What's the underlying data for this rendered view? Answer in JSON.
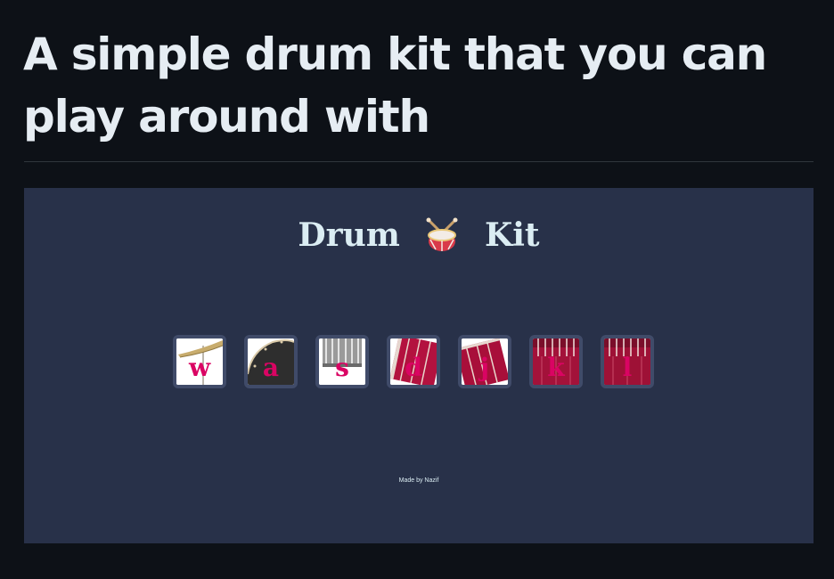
{
  "readme": {
    "heading": "A simple drum kit that you can play around with"
  },
  "preview": {
    "title_left": "Drum",
    "title_icon": "drum-emoji-icon",
    "title_right": "Kit",
    "keys": [
      {
        "letter": "w",
        "instrument": "crash-cymbal-icon"
      },
      {
        "letter": "a",
        "instrument": "kick-drum-icon"
      },
      {
        "letter": "s",
        "instrument": "snare-drum-icon"
      },
      {
        "letter": "d",
        "instrument": "tom-drum-icon"
      },
      {
        "letter": "j",
        "instrument": "tom-drum-icon"
      },
      {
        "letter": "k",
        "instrument": "tom-drum-icon"
      },
      {
        "letter": "l",
        "instrument": "tom-drum-icon"
      }
    ],
    "credit": "Made by Nazif"
  },
  "colors": {
    "page_background": "#0d1117",
    "preview_background": "#283149",
    "key_border": "#404b69",
    "key_letter": "#da0463",
    "drum_red": "#b3123f",
    "title_text": "#dbedf3"
  }
}
